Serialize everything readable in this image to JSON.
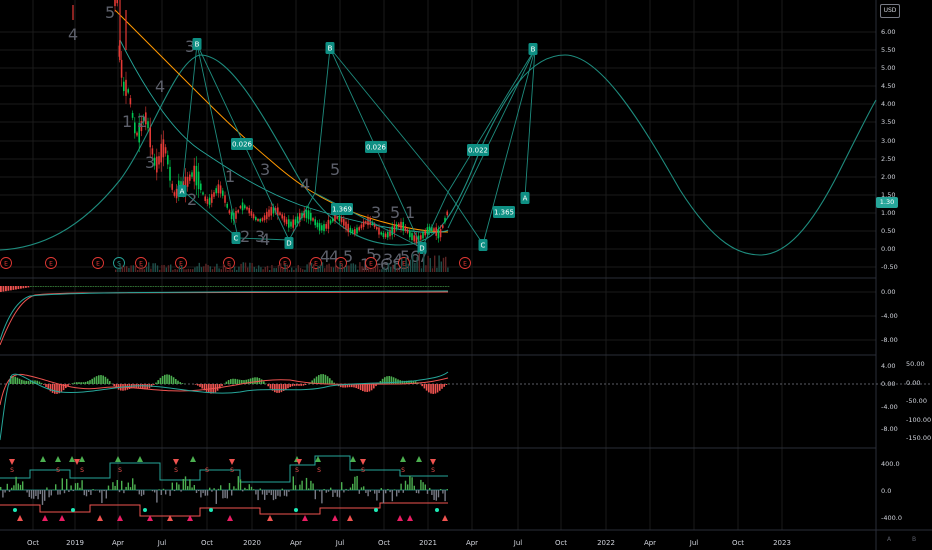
{
  "currency": "USD",
  "last_price": "1.30",
  "price_axis": [
    "6.00",
    "5.50",
    "5.00",
    "4.50",
    "4.00",
    "3.50",
    "3.00",
    "2.50",
    "2.00",
    "1.50",
    "1.00",
    "0.50",
    "0.00",
    "-0.50"
  ],
  "pane2_axis": [
    "0.00",
    "-4.00",
    "-8.00"
  ],
  "pane3_axis_left": [
    "4.00",
    "0.00",
    "-4.00",
    "-8.00"
  ],
  "pane3_axis_right": [
    "50.00",
    "0.00",
    "-50.00",
    "-100.00",
    "-150.00"
  ],
  "pane4_axis": [
    "400.0",
    "0.0",
    "-400.0"
  ],
  "time_axis": [
    "Oct",
    "2019",
    "Apr",
    "Jul",
    "Oct",
    "2020",
    "Apr",
    "Jul",
    "Oct",
    "2021",
    "Apr",
    "Jul",
    "Oct",
    "2022",
    "Apr",
    "Jul",
    "Oct",
    "2023"
  ],
  "timezone_labels": [
    "A",
    "B"
  ],
  "pattern_labels": [
    "0.026",
    "0.026",
    "0.022",
    "1.369",
    "1.365",
    "A",
    "B",
    "B",
    "B",
    "A",
    "C",
    "D",
    "C",
    "D"
  ],
  "wave_counts": [
    "5",
    "4",
    "3",
    "4",
    "1",
    "2",
    "3",
    "1",
    "2",
    "3",
    "4",
    "5",
    "3",
    "5",
    "1",
    "2",
    "3",
    "4",
    "5",
    "4",
    "1",
    "2",
    "3",
    "4",
    "5",
    "6",
    "8",
    "4",
    "5",
    "6",
    "7"
  ],
  "earnings_markers": [
    "E",
    "E",
    "E",
    "S",
    "E",
    "E",
    "E",
    "E",
    "E",
    "E",
    "E",
    "E",
    "E"
  ],
  "signal_tags": [
    "S",
    "S",
    "S",
    "S",
    "S",
    "S",
    "S",
    "S",
    "S",
    "S",
    "S",
    "S"
  ],
  "colors": {
    "background": "#000000",
    "grid": "#1c1c1c",
    "bull": "#26a69a",
    "bear": "#ef5350",
    "candle_up": "#00c853",
    "candle_down": "#e53935",
    "cycle_line": "#1e8c7e",
    "ma_orange": "#ff9800",
    "label_bg": "#0e8f83",
    "earnings": "#e53935"
  }
}
